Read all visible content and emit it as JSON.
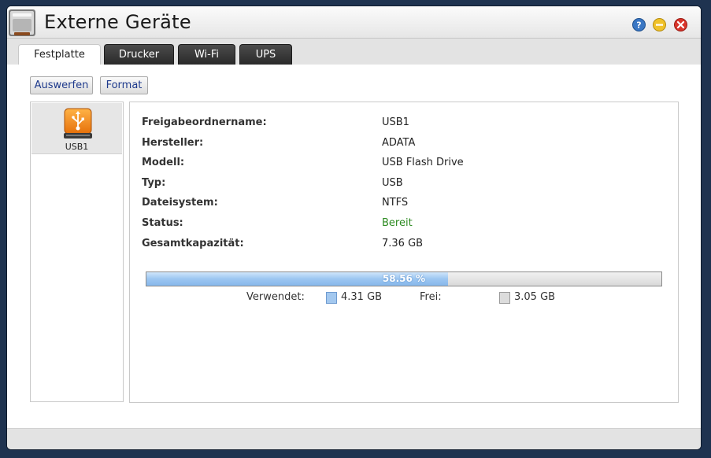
{
  "window": {
    "title": "Externe Geräte",
    "icons": [
      "external-drive-app-icon",
      "help-icon",
      "minimize-icon",
      "close-icon"
    ]
  },
  "tabs": [
    {
      "label": "Festplatte",
      "active": true
    },
    {
      "label": "Drucker",
      "active": false
    },
    {
      "label": "Wi-Fi",
      "active": false
    },
    {
      "label": "UPS",
      "active": false
    }
  ],
  "toolbar": {
    "eject_label": "Auswerfen",
    "format_label": "Format"
  },
  "devices": [
    {
      "label": "USB1",
      "icon": "usb-drive-icon",
      "selected": true
    }
  ],
  "details": {
    "rows": [
      {
        "label": "Freigabeordnername:",
        "value": "USB1"
      },
      {
        "label": "Hersteller:",
        "value": "ADATA"
      },
      {
        "label": "Modell:",
        "value": "USB Flash Drive"
      },
      {
        "label": "Typ:",
        "value": "USB"
      },
      {
        "label": "Dateisystem:",
        "value": "NTFS"
      },
      {
        "label": "Status:",
        "value": "Bereit"
      },
      {
        "label": "Gesamtkapazität:",
        "value": "7.36 GB"
      }
    ],
    "usage": {
      "percent_label": "58.56 %",
      "used_fraction": 0.5856,
      "used_label": "Verwendet:",
      "used_value": "4.31 GB",
      "free_label": "Frei:",
      "free_value": "3.05 GB"
    }
  },
  "colors": {
    "status_ok": "#2e8b22",
    "bar_used": "#9cc6f1",
    "tab_dark": "#333333",
    "link_blue": "#1e3a8c"
  }
}
